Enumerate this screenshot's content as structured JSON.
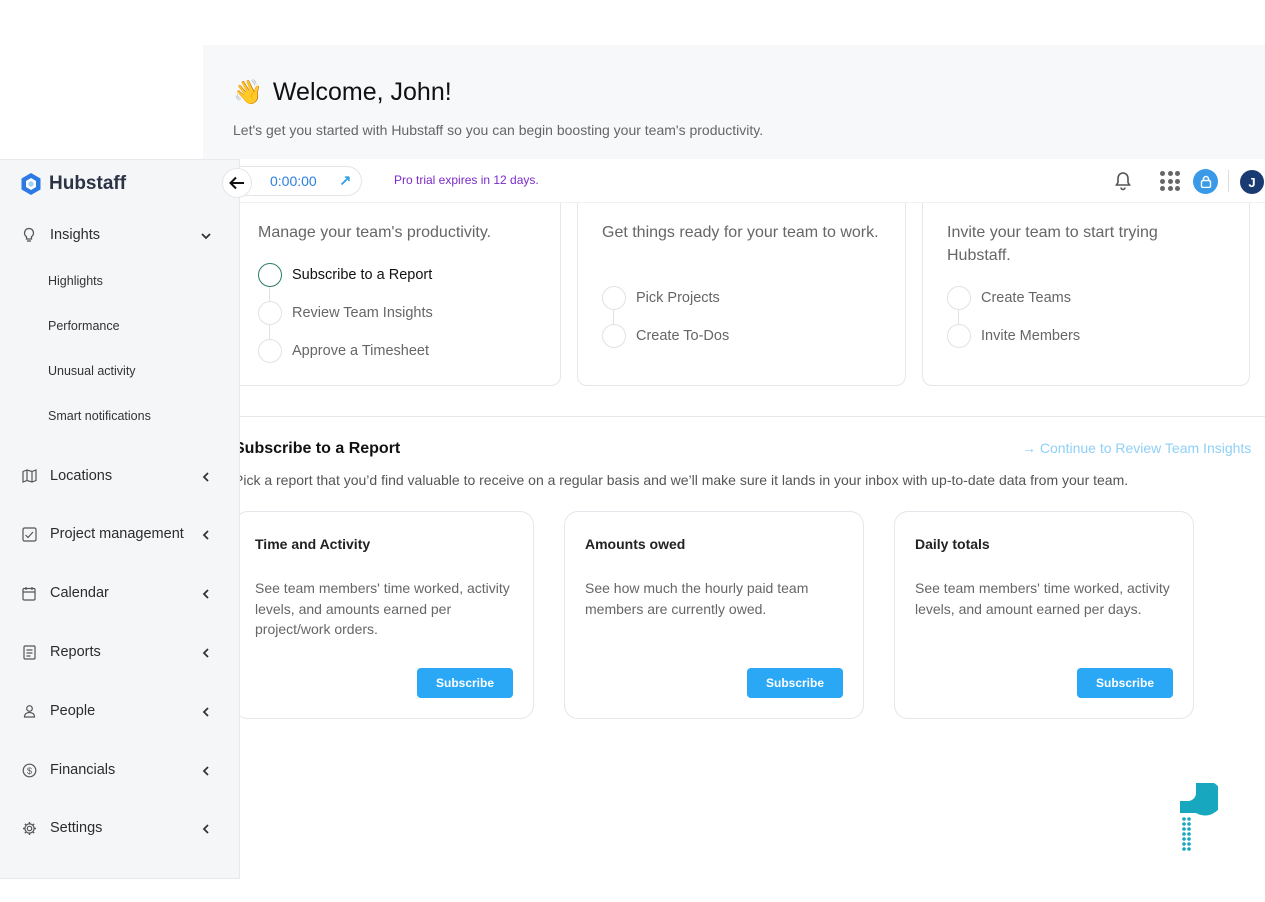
{
  "welcome": {
    "title": "Welcome, John!",
    "subtitle": "Let's get you started with Hubstaff so you can begin boosting your team's productivity."
  },
  "topbar": {
    "timer": "0:00:00",
    "trial_text": "Pro trial expires in 12 days.",
    "avatar_initial": "J"
  },
  "sidebar": {
    "brand": "Hubstaff",
    "items": [
      {
        "label": "Insights",
        "icon": "lightbulb-icon",
        "expanded": true
      },
      {
        "label": "Locations",
        "icon": "map-icon"
      },
      {
        "label": "Project management",
        "icon": "checklist-icon"
      },
      {
        "label": "Calendar",
        "icon": "calendar-icon"
      },
      {
        "label": "Reports",
        "icon": "report-icon"
      },
      {
        "label": "People",
        "icon": "person-icon"
      },
      {
        "label": "Financials",
        "icon": "dollar-icon"
      },
      {
        "label": "Settings",
        "icon": "gear-icon"
      }
    ],
    "insights_sub": [
      "Highlights",
      "Performance",
      "Unusual activity",
      "Smart notifications"
    ]
  },
  "steps": [
    {
      "desc": "Manage your team's productivity.",
      "items": [
        "Subscribe to a Report",
        "Review Team Insights",
        "Approve a Timesheet"
      ]
    },
    {
      "desc": "Get things ready for your team to work.",
      "items": [
        "Pick Projects",
        "Create To-Dos"
      ]
    },
    {
      "desc": "Invite your team to start trying Hubstaff.",
      "items": [
        "Create Teams",
        "Invite Members"
      ]
    }
  ],
  "subscribe": {
    "title": "Subscribe to a Report",
    "continue_link": "→ Continue to Review Team Insights",
    "desc": "Pick a report that you’d find valuable to receive on a regular basis and we’ll make sure it lands in your inbox with up-to-date data from your team.",
    "reports": [
      {
        "title": "Time and Activity",
        "desc": "See team members' time worked, activity levels, and amounts earned per project/work orders.",
        "button": "Subscribe"
      },
      {
        "title": "Amounts owed",
        "desc": "See how much the hourly paid team members are currently owed.",
        "button": "Subscribe"
      },
      {
        "title": "Daily totals",
        "desc": "See team members' time worked, activity levels, and amount earned per days.",
        "button": "Subscribe"
      }
    ]
  },
  "colors": {
    "accent": "#2aa8f5",
    "trial": "#7b2bc9",
    "brand": "#2c3345"
  }
}
